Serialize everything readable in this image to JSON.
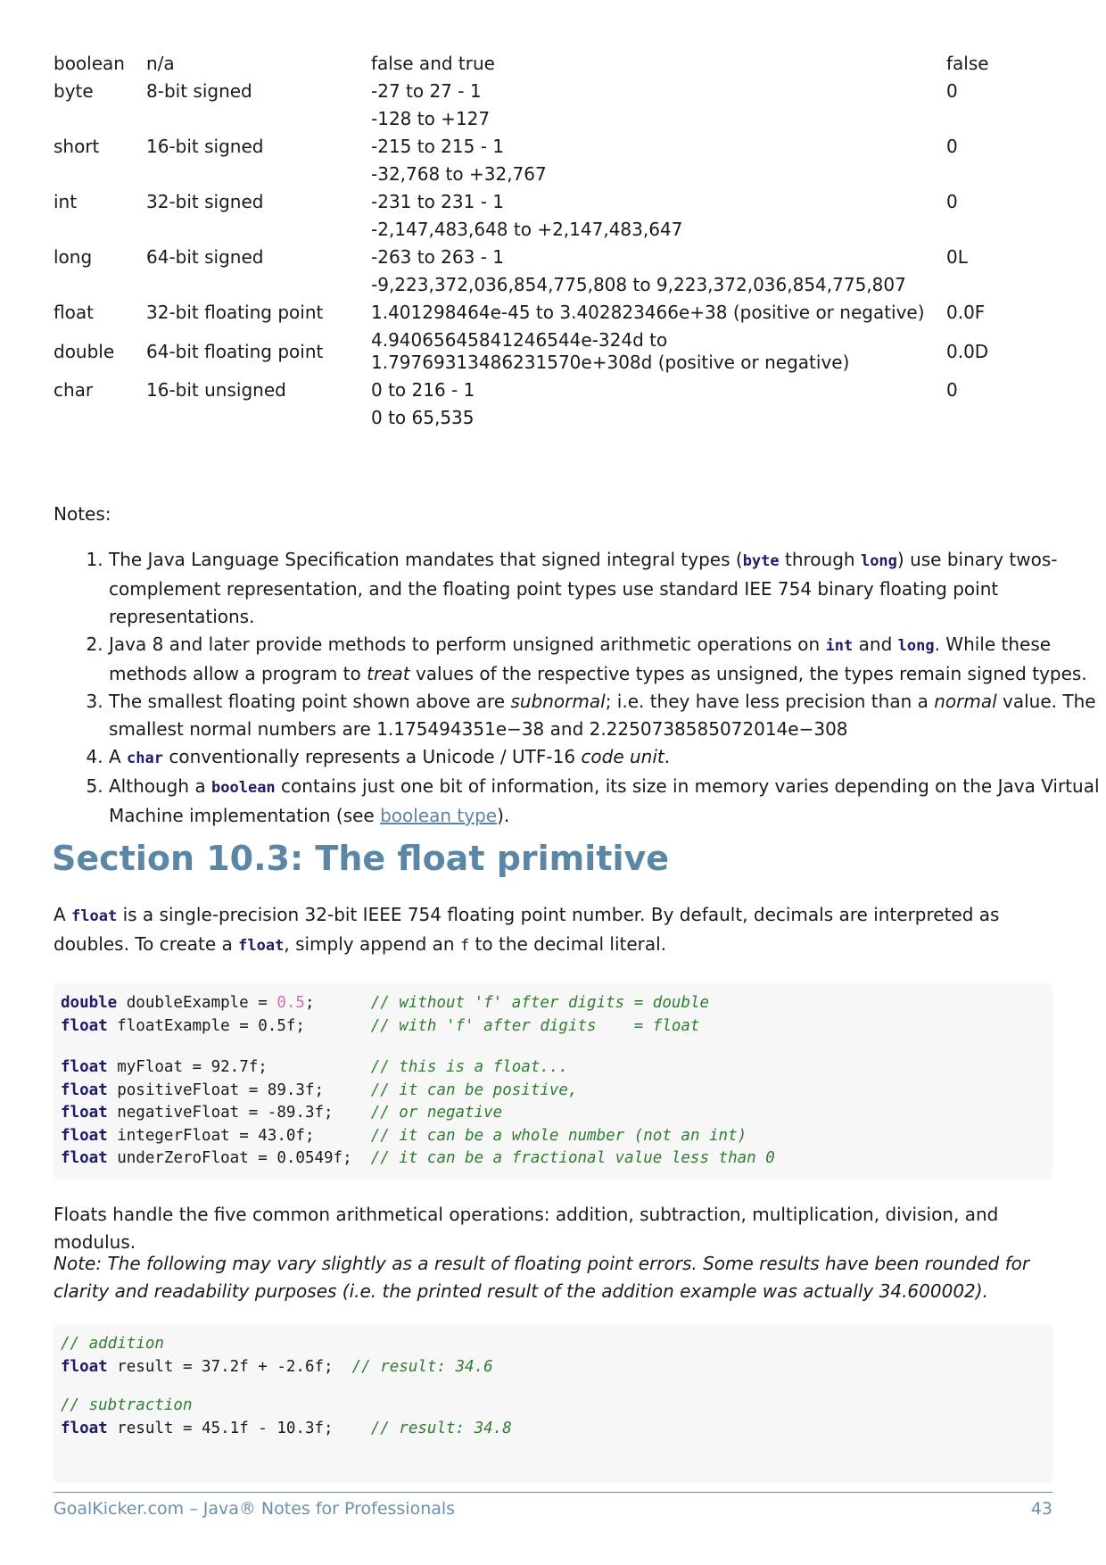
{
  "table": {
    "rows": [
      {
        "type": "boolean",
        "desc": "n/a",
        "range": "false and true",
        "default": "false"
      },
      {
        "type": "byte",
        "desc": "8-bit signed",
        "range": "-27 to 27 - 1",
        "default": "0"
      },
      {
        "type": "",
        "desc": "",
        "range": "-128 to +127",
        "default": ""
      },
      {
        "type": "short",
        "desc": "16-bit signed",
        "range": "-215 to 215 - 1",
        "default": "0"
      },
      {
        "type": "",
        "desc": "",
        "range": "-32,768 to +32,767",
        "default": ""
      },
      {
        "type": "int",
        "desc": "32-bit signed",
        "range": "-231 to 231 - 1",
        "default": "0"
      },
      {
        "type": "",
        "desc": "",
        "range": "-2,147,483,648 to +2,147,483,647",
        "default": ""
      },
      {
        "type": "long",
        "desc": "64-bit signed",
        "range": "-263 to 263 - 1",
        "default": "0L"
      },
      {
        "type": "",
        "desc": "",
        "range": "-9,223,372,036,854,775,808 to 9,223,372,036,854,775,807",
        "default": ""
      },
      {
        "type": "float",
        "desc": "32-bit floating point",
        "range": "1.401298464e-45 to 3.402823466e+38 (positive or negative)",
        "default": "0.0F"
      },
      {
        "type": "double",
        "desc": "64-bit floating point",
        "range": "4.94065645841246544e-324d to 1.79769313486231570e+308d (positive or negative)",
        "default": "0.0D"
      },
      {
        "type": "char",
        "desc": "16-bit unsigned",
        "range": "0 to 216 - 1",
        "default": "0"
      },
      {
        "type": "",
        "desc": "",
        "range": "0 to 65,535",
        "default": ""
      }
    ]
  },
  "notes": {
    "label": "Notes:",
    "n1": {
      "a": "The Java Language Specification mandates that signed integral types (",
      "c1": "byte",
      "b": " through ",
      "c2": "long",
      "d": ") use binary twos-complement representation, and the floating point types use standard IEE 754 binary floating point representations."
    },
    "n2": {
      "a": "Java 8 and later provide methods to perform unsigned arithmetic operations on ",
      "c1": "int",
      "b": " and ",
      "c2": "long",
      "c": ". While these methods allow a program to ",
      "em": "treat",
      "d": " values of the respective types as unsigned, the types remain signed types."
    },
    "n3": {
      "a": "The smallest floating point shown above are ",
      "em1": "subnormal",
      "b": "; i.e. they have less precision than a ",
      "em2": "normal",
      "c": " value. The smallest normal numbers are 1.175494351e−38 and 2.2250738585072014e−308"
    },
    "n4": {
      "a": "A ",
      "c1": "char",
      "b": " conventionally represents a Unicode / UTF-16 ",
      "em": "code unit",
      "c": "."
    },
    "n5": {
      "a": "Although a ",
      "c1": "boolean",
      "b": " contains just one bit of information, its size in memory varies depending on the Java Virtual Machine implementation (see ",
      "link": "boolean type",
      "c": ")."
    }
  },
  "section": {
    "title": "Section 10.3: The float primitive",
    "p1": {
      "a": "A ",
      "c1": "float",
      "b": " is a single-precision 32-bit IEEE 754 floating point number. By default, decimals are interpreted as doubles. To create a ",
      "c2": "float",
      "c": ", simply append an ",
      "c3": "f",
      "d": " to the decimal literal."
    },
    "p2": "Floats handle the five common arithmetical operations: addition, subtraction, multiplication, division, and modulus.",
    "p3": "Note: The following may vary slightly as a result of floating point errors. Some results have been rounded for clarity and readability purposes (i.e. the printed result of the addition example was actually 34.600002)."
  },
  "code1": [
    {
      "kw": "double",
      "rest": " doubleExample = ",
      "val": "0.5",
      "pad": ";      ",
      "cm": "// without 'f' after digits = double"
    },
    {
      "kw": "float",
      "rest": " floatExample = 0.5f",
      "val": "",
      "pad": ";       ",
      "cm": "// with 'f' after digits    = float"
    },
    {
      "kw": "",
      "rest": "",
      "val": "",
      "pad": "",
      "cm": ""
    },
    {
      "kw": "float",
      "rest": " myFloat = 92.7f",
      "val": "",
      "pad": ";           ",
      "cm": "// this is a float..."
    },
    {
      "kw": "float",
      "rest": " positiveFloat = 89.3f",
      "val": "",
      "pad": ";     ",
      "cm": "// it can be positive,"
    },
    {
      "kw": "float",
      "rest": " negativeFloat = -89.3f",
      "val": "",
      "pad": ";    ",
      "cm": "// or negative"
    },
    {
      "kw": "float",
      "rest": " integerFloat = 43.0f",
      "val": "",
      "pad": ";      ",
      "cm": "// it can be a whole number (not an int)"
    },
    {
      "kw": "float",
      "rest": " underZeroFloat = 0.0549f",
      "val": "",
      "pad": ";  ",
      "cm": "// it can be a fractional value less than 0"
    }
  ],
  "code2": [
    {
      "kw": "",
      "rest": "",
      "pad": "",
      "cm": "// addition"
    },
    {
      "kw": "float",
      "rest": " result = 37.2f + -2.6f",
      "pad": ";  ",
      "cm": "// result: 34.6"
    },
    {
      "kw": "",
      "rest": "",
      "pad": "",
      "cm": ""
    },
    {
      "kw": "",
      "rest": "",
      "pad": "",
      "cm": "// subtraction"
    },
    {
      "kw": "float",
      "rest": " result = 45.1f - 10.3f",
      "pad": ";    ",
      "cm": "// result: 34.8"
    }
  ],
  "footer": {
    "left": "GoalKicker.com – Java® Notes for Professionals",
    "page": "43"
  }
}
